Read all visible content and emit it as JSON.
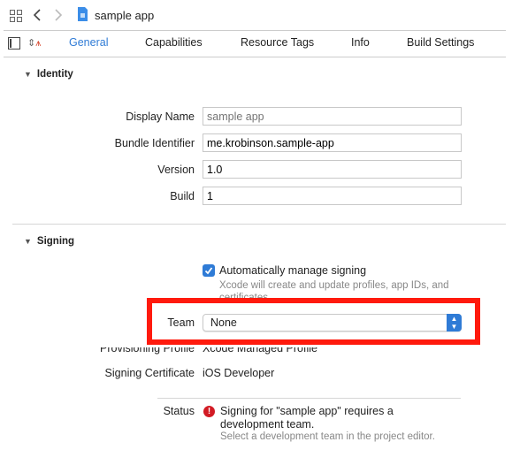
{
  "toolbar": {
    "title": "sample app",
    "icons": [
      "grid-icon",
      "back-chevron-icon",
      "forward-chevron-icon",
      "project-file-icon"
    ]
  },
  "tabs": [
    {
      "label": "General",
      "active": true
    },
    {
      "label": "Capabilities"
    },
    {
      "label": "Resource Tags"
    },
    {
      "label": "Info"
    },
    {
      "label": "Build Settings"
    }
  ],
  "accent": "#2f7bd6",
  "identity": {
    "header": "Identity",
    "display_name": {
      "label": "Display Name",
      "placeholder": "sample app"
    },
    "bundle_id": {
      "label": "Bundle Identifier",
      "value": "me.krobinson.sample-app"
    },
    "version": {
      "label": "Version",
      "value": "1.0"
    },
    "build": {
      "label": "Build",
      "value": "1"
    }
  },
  "signing": {
    "header": "Signing",
    "auto_manage": {
      "label": "Automatically manage signing",
      "checked": true,
      "description": "Xcode will create and update profiles, app IDs, and certificates."
    },
    "team": {
      "label": "Team",
      "value": "None"
    },
    "profile": {
      "label": "Provisioning Profile",
      "value": "Xcode Managed Profile"
    },
    "certificate": {
      "label": "Signing Certificate",
      "value": "iOS Developer"
    },
    "status": {
      "label": "Status",
      "message": "Signing for \"sample app\" requires a development team.",
      "detail": "Select a development team in the project editor."
    }
  },
  "highlight_color": "#ff1a0d"
}
